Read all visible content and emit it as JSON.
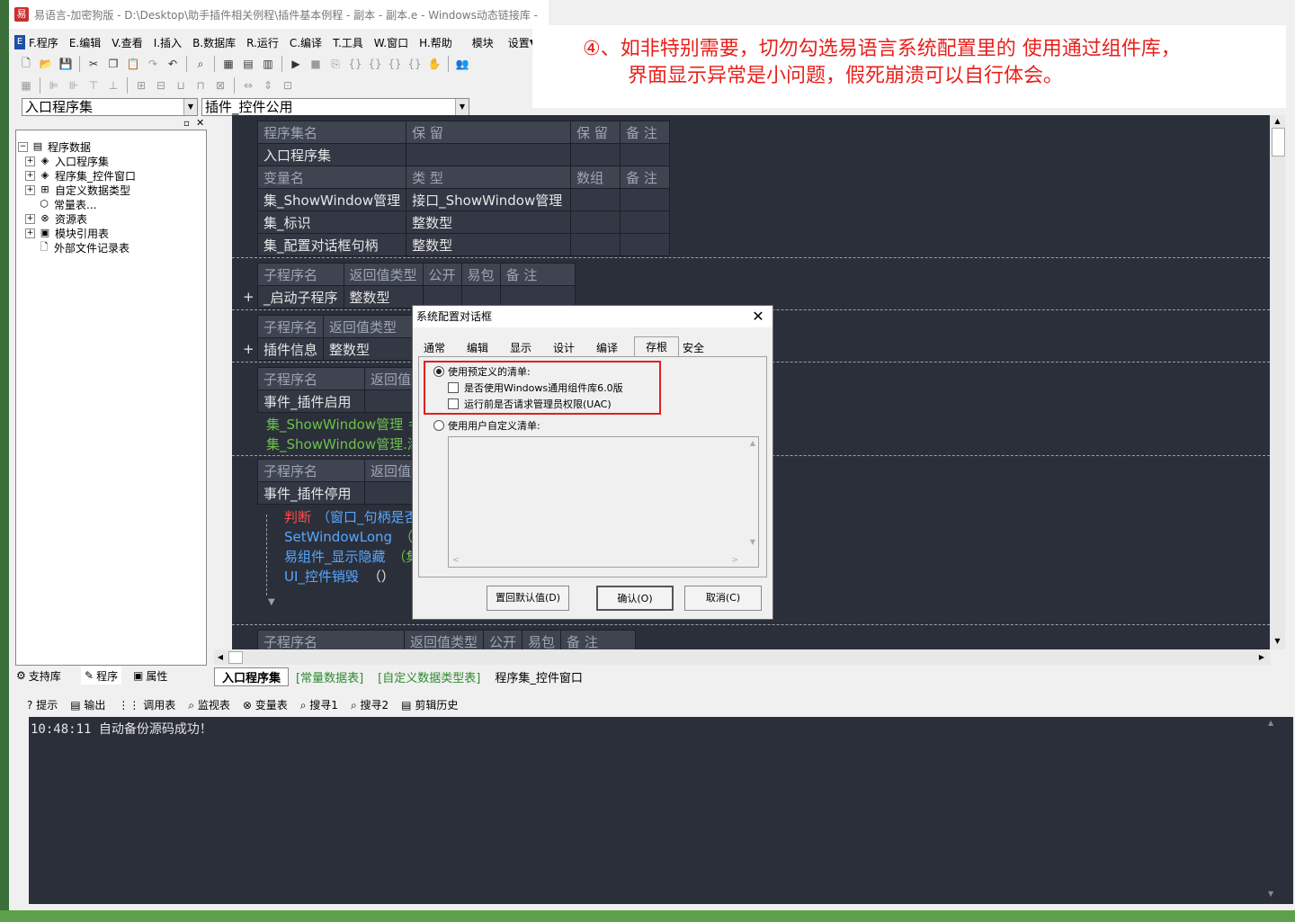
{
  "window": {
    "title": "易语言-加密狗版 - D:\\Desktop\\助手插件相关例程\\插件基本例程 - 副本 - 副本.e - Windows动态链接库 -"
  },
  "menu": [
    "F.程序",
    "E.编辑",
    "V.查看",
    "I.插入",
    "B.数据库",
    "R.运行",
    "C.编译",
    "T.工具",
    "W.窗口",
    "H.帮助",
    "模块",
    "设置▼"
  ],
  "annotation": {
    "line1": "④、如非特别需要，切勿勾选易语言系统配置里的 使用通过组件库，",
    "line2": "界面显示异常是小问题，假死崩溃可以自行体会。"
  },
  "combos": {
    "left": "入口程序集",
    "right": "插件_控件公用"
  },
  "tree": {
    "root": "程序数据",
    "items": [
      "入口程序集",
      "程序集_控件窗口",
      "自定义数据类型",
      "常量表...",
      "资源表",
      "模块引用表",
      "外部文件记录表"
    ]
  },
  "left_tabs": [
    "支持库",
    "程序",
    "属性"
  ],
  "editor": {
    "assembly": {
      "headers": [
        "程序集名",
        "保 留",
        "保 留",
        "备 注"
      ],
      "name": "入口程序集",
      "var_headers": [
        "变量名",
        "类 型",
        "数组",
        "备 注"
      ],
      "vars": [
        [
          "集_ShowWindow管理",
          "接口_ShowWindow管理"
        ],
        [
          "集_标识",
          "整数型"
        ],
        [
          "集_配置对话框句柄",
          "整数型"
        ]
      ]
    },
    "sub_headers_full": [
      "子程序名",
      "返回值类型",
      "公开",
      "易包",
      "备 注"
    ],
    "sub_header_short": [
      "子程序名",
      "返回值类型"
    ],
    "sub_header_tiny": [
      "子程序名",
      "返回值"
    ],
    "sub1": {
      "name": "_启动子程序",
      "type": "整数型"
    },
    "sub2": {
      "name": "插件信息",
      "type": "整数型"
    },
    "sub3": {
      "name": "事件_插件启用"
    },
    "code3": [
      "集_ShowWindow管理 ＝ 其",
      "集_ShowWindow管理.添加"
    ],
    "sub4": {
      "name": "事件_插件停用"
    },
    "code4": {
      "if_kw": "判断",
      "if_rest": "（窗口_句柄是否",
      "l2a": "SetWindowLong",
      "l2b": "（集_配",
      "l3a": "易组件_显示隐藏",
      "l3b": "（集",
      "l4a": "UI_控件销毁",
      "l4b": "（）"
    },
    "plus": "+"
  },
  "editor_tabs": [
    "入口程序集",
    "[常量数据表]",
    "[自定义数据类型表]",
    "程序集_控件窗口"
  ],
  "output_tabs": [
    "提示",
    "输出",
    "调用表",
    "监视表",
    "变量表",
    "搜寻1",
    "搜寻2",
    "剪辑历史"
  ],
  "output_text": "10:48:11 自动备份源码成功！",
  "dialog": {
    "title": "系统配置对话框",
    "tabs": [
      "通常",
      "编辑",
      "显示",
      "设计",
      "编译",
      "存根",
      "安全"
    ],
    "active_tab": "存根",
    "radio1": "使用预定义的清单:",
    "check1": "是否使用Windows通用组件库6.0版",
    "check2": "运行前是否请求管理员权限(UAC)",
    "radio2": "使用用户自定义清单:",
    "buttons": {
      "reset": "置回默认值(D)",
      "ok": "确认(O)",
      "cancel": "取消(C)"
    },
    "highlight_color": "#e02020"
  }
}
